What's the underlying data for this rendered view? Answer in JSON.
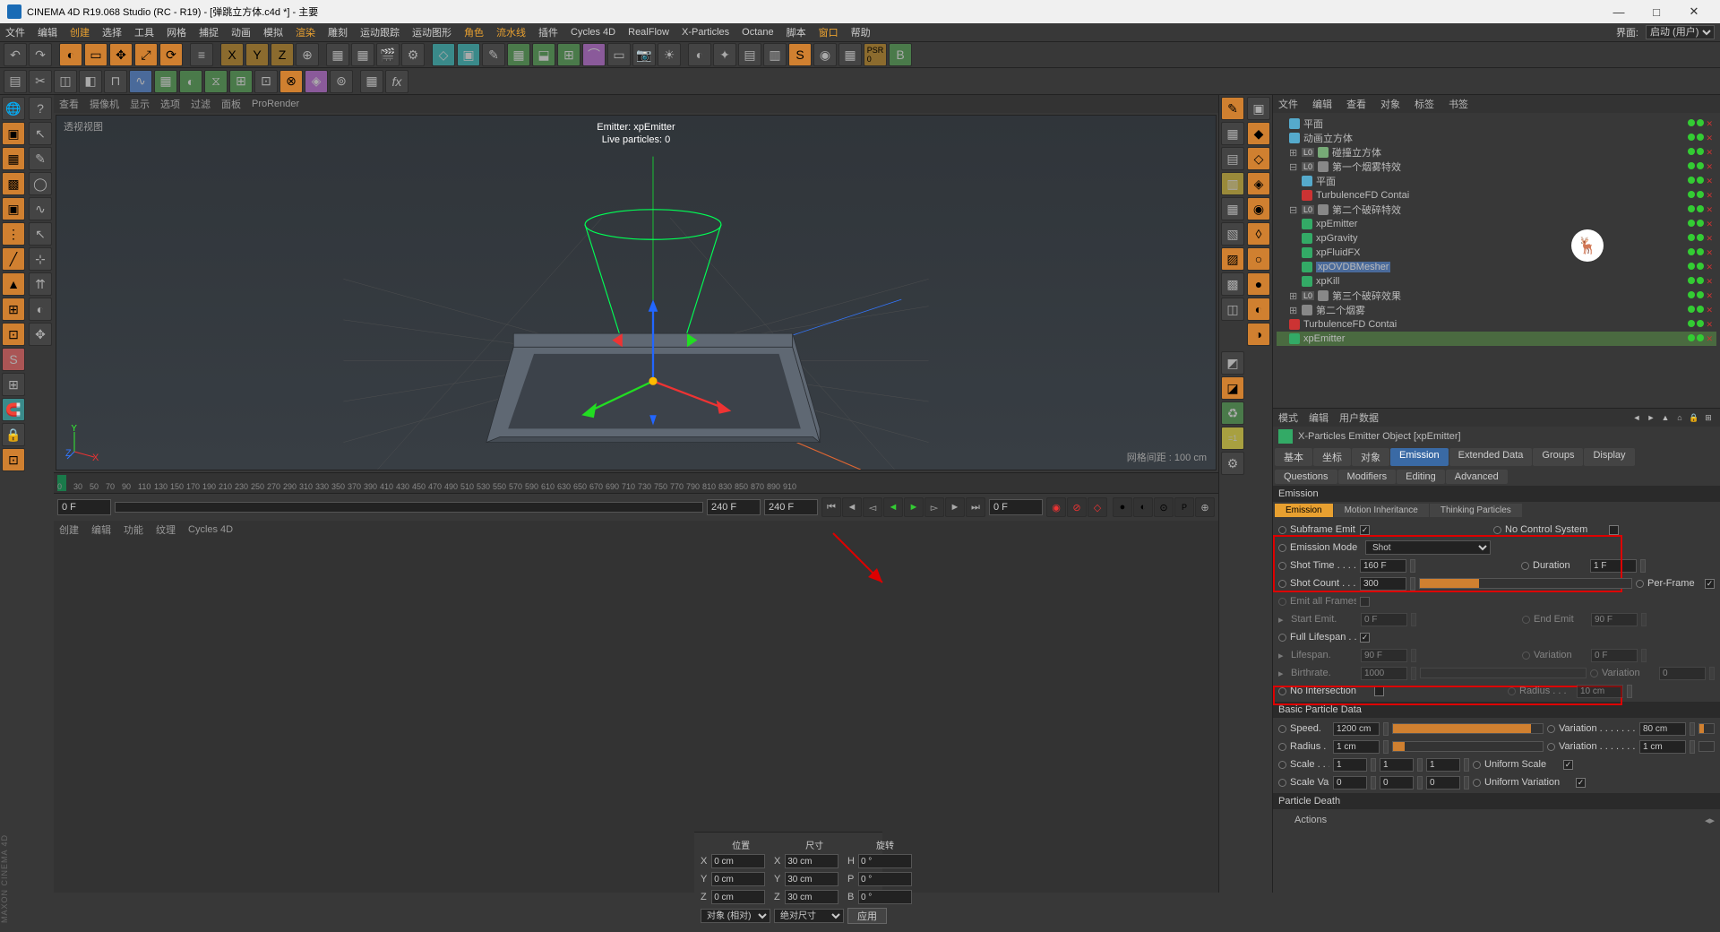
{
  "title": "CINEMA 4D R19.068 Studio (RC - R19) - [弹跳立方体.c4d *] - 主要",
  "win_controls": {
    "min": "—",
    "max": "□",
    "close": "✕"
  },
  "menubar": [
    "文件",
    "编辑",
    "创建",
    "选择",
    "工具",
    "网格",
    "捕捉",
    "动画",
    "模拟",
    "渲染",
    "雕刻",
    "运动跟踪",
    "运动图形",
    "角色",
    "流水线",
    "插件",
    "Cycles 4D",
    "RealFlow",
    "X-Particles",
    "Octane",
    "脚本",
    "窗口",
    "帮助",
    "",
    "界面:",
    "启动 (用户)"
  ],
  "view_tabs": [
    "查看",
    "摄像机",
    "显示",
    "选项",
    "过滤",
    "面板",
    "ProRender"
  ],
  "viewport": {
    "label": "透视视图",
    "emitter": "Emitter: xpEmitter",
    "live": "Live particles: 0",
    "grid": "网格间距 : 100 cm"
  },
  "ruler": {
    "start": 0,
    "end": 920,
    "step": 40,
    "ticks": [
      0,
      30,
      50,
      70,
      90,
      110,
      130,
      150,
      170,
      190,
      210,
      230,
      250,
      270,
      290,
      310,
      330,
      350,
      370,
      390,
      410,
      430,
      450,
      470,
      490,
      510,
      530,
      550,
      570,
      590,
      610,
      630,
      650,
      670,
      690,
      710,
      730,
      750,
      770,
      790,
      810,
      830,
      850,
      870,
      890,
      910
    ]
  },
  "transport": {
    "f1": "0 F",
    "f2": "240 F",
    "f3": "240 F",
    "f4": "0 F"
  },
  "bottom_tabs": [
    "创建",
    "编辑",
    "功能",
    "纹理",
    "Cycles 4D"
  ],
  "coordbar": {
    "headers": [
      "位置",
      "尺寸",
      "旋转"
    ],
    "rows": [
      {
        "axis": "X",
        "pos": "0 cm",
        "size": "30 cm",
        "rot_lbl": "H",
        "rot": "0 °"
      },
      {
        "axis": "Y",
        "pos": "0 cm",
        "size": "30 cm",
        "rot_lbl": "P",
        "rot": "0 °"
      },
      {
        "axis": "Z",
        "pos": "0 cm",
        "size": "30 cm",
        "rot_lbl": "B",
        "rot": "0 °"
      }
    ],
    "mode1": "对象 (相对)",
    "mode2": "绝对尺寸",
    "apply": "应用"
  },
  "obj_tabs": [
    "文件",
    "编辑",
    "查看",
    "对象",
    "标签",
    "书签"
  ],
  "obj_tree": [
    {
      "indent": 1,
      "name": "平面",
      "icon": "#5ac"
    },
    {
      "indent": 1,
      "name": "动画立方体",
      "icon": "#5ac"
    },
    {
      "indent": 1,
      "name": "碰撞立方体",
      "icon": "#7a7",
      "expand": "+",
      "pre": "L0"
    },
    {
      "indent": 1,
      "name": "第一个烟雾特效",
      "icon": "#888",
      "expand": "-",
      "pre": "L0"
    },
    {
      "indent": 2,
      "name": "平面",
      "icon": "#5ac"
    },
    {
      "indent": 2,
      "name": "TurbulenceFD Contai",
      "icon": "#c33"
    },
    {
      "indent": 1,
      "name": "第二个破碎特效",
      "icon": "#888",
      "expand": "-",
      "pre": "L0"
    },
    {
      "indent": 2,
      "name": "xpEmitter",
      "icon": "#3a6"
    },
    {
      "indent": 2,
      "name": "xpGravity",
      "icon": "#3a6"
    },
    {
      "indent": 2,
      "name": "xpFluidFX",
      "icon": "#3a6"
    },
    {
      "indent": 2,
      "name": "xpOVDBMesher",
      "icon": "#3a6",
      "sel": true
    },
    {
      "indent": 2,
      "name": "xpKill",
      "icon": "#3a6"
    },
    {
      "indent": 1,
      "name": "第三个破碎效果",
      "icon": "#888",
      "expand": "+",
      "pre": "L0"
    },
    {
      "indent": 1,
      "name": "第二个烟雾",
      "icon": "#888",
      "expand": "+"
    },
    {
      "indent": 1,
      "name": "TurbulenceFD Contai",
      "icon": "#c33"
    },
    {
      "indent": 1,
      "name": "xpEmitter",
      "icon": "#3a6",
      "hilite": true
    }
  ],
  "attr_tabs": [
    "模式",
    "编辑",
    "用户数据"
  ],
  "attr_head": "X-Particles Emitter Object [xpEmitter]",
  "attr_main_tabs": [
    "基本",
    "坐标",
    "对象",
    "Emission",
    "Extended Data",
    "Groups",
    "Display"
  ],
  "attr_main_active": "Emission",
  "attr_sub_tabs": [
    "Questions",
    "Modifiers",
    "Editing",
    "Advanced"
  ],
  "section1": "Emission",
  "emission_subtabs": [
    "Emission",
    "Motion Inheritance",
    "Thinking Particles"
  ],
  "emission_sub_active": "Emission",
  "params": {
    "subframe": "Subframe Emit",
    "nocontrol": "No Control System",
    "mode_lbl": "Emission Mode",
    "mode_val": "Shot",
    "shottime_lbl": "Shot Time . . . . .",
    "shottime_val": "160 F",
    "duration_lbl": "Duration",
    "duration_val": "1 F",
    "shotcount_lbl": "Shot Count . . .",
    "shotcount_val": "300",
    "perframe_lbl": "Per-Frame",
    "emitall": "Emit all Frames",
    "startemit_lbl": "Start Emit.",
    "startemit_val": "0 F",
    "endemit_lbl": "End Emit",
    "endemit_val": "90 F",
    "fulllife": "Full Lifespan . .",
    "lifespan_lbl": "Lifespan.",
    "lifespan_val": "90 F",
    "lifevar_lbl": "Variation",
    "lifevar_val": "0 F",
    "birth_lbl": "Birthrate.",
    "birth_val": "1000",
    "birthvar_lbl": "Variation",
    "birthvar_val": "0",
    "noint": "No Intersection",
    "radiusint_lbl": "Radius . . .",
    "radiusint_val": "10 cm",
    "section2": "Basic Particle Data",
    "speed_lbl": "Speed.",
    "speed_val": "1200 cm",
    "speedvar_lbl": "Variation . . . . . . . .",
    "speedvar_val": "80 cm",
    "radius_lbl": "Radius . . .",
    "radius_val": "1 cm",
    "radvar_lbl": "Variation . . . . . . . .",
    "radvar_val": "1 cm",
    "scale_lbl": "Scale . . . . .",
    "scalex": "1",
    "scaley": "1",
    "scalez": "1",
    "unisc": "Uniform Scale",
    "scalevar_lbl": "Scale Var. .",
    "svx": "0",
    "svy": "0",
    "svz": "0",
    "univar": "Uniform Variation",
    "section3": "Particle Death",
    "actions": "Actions"
  }
}
